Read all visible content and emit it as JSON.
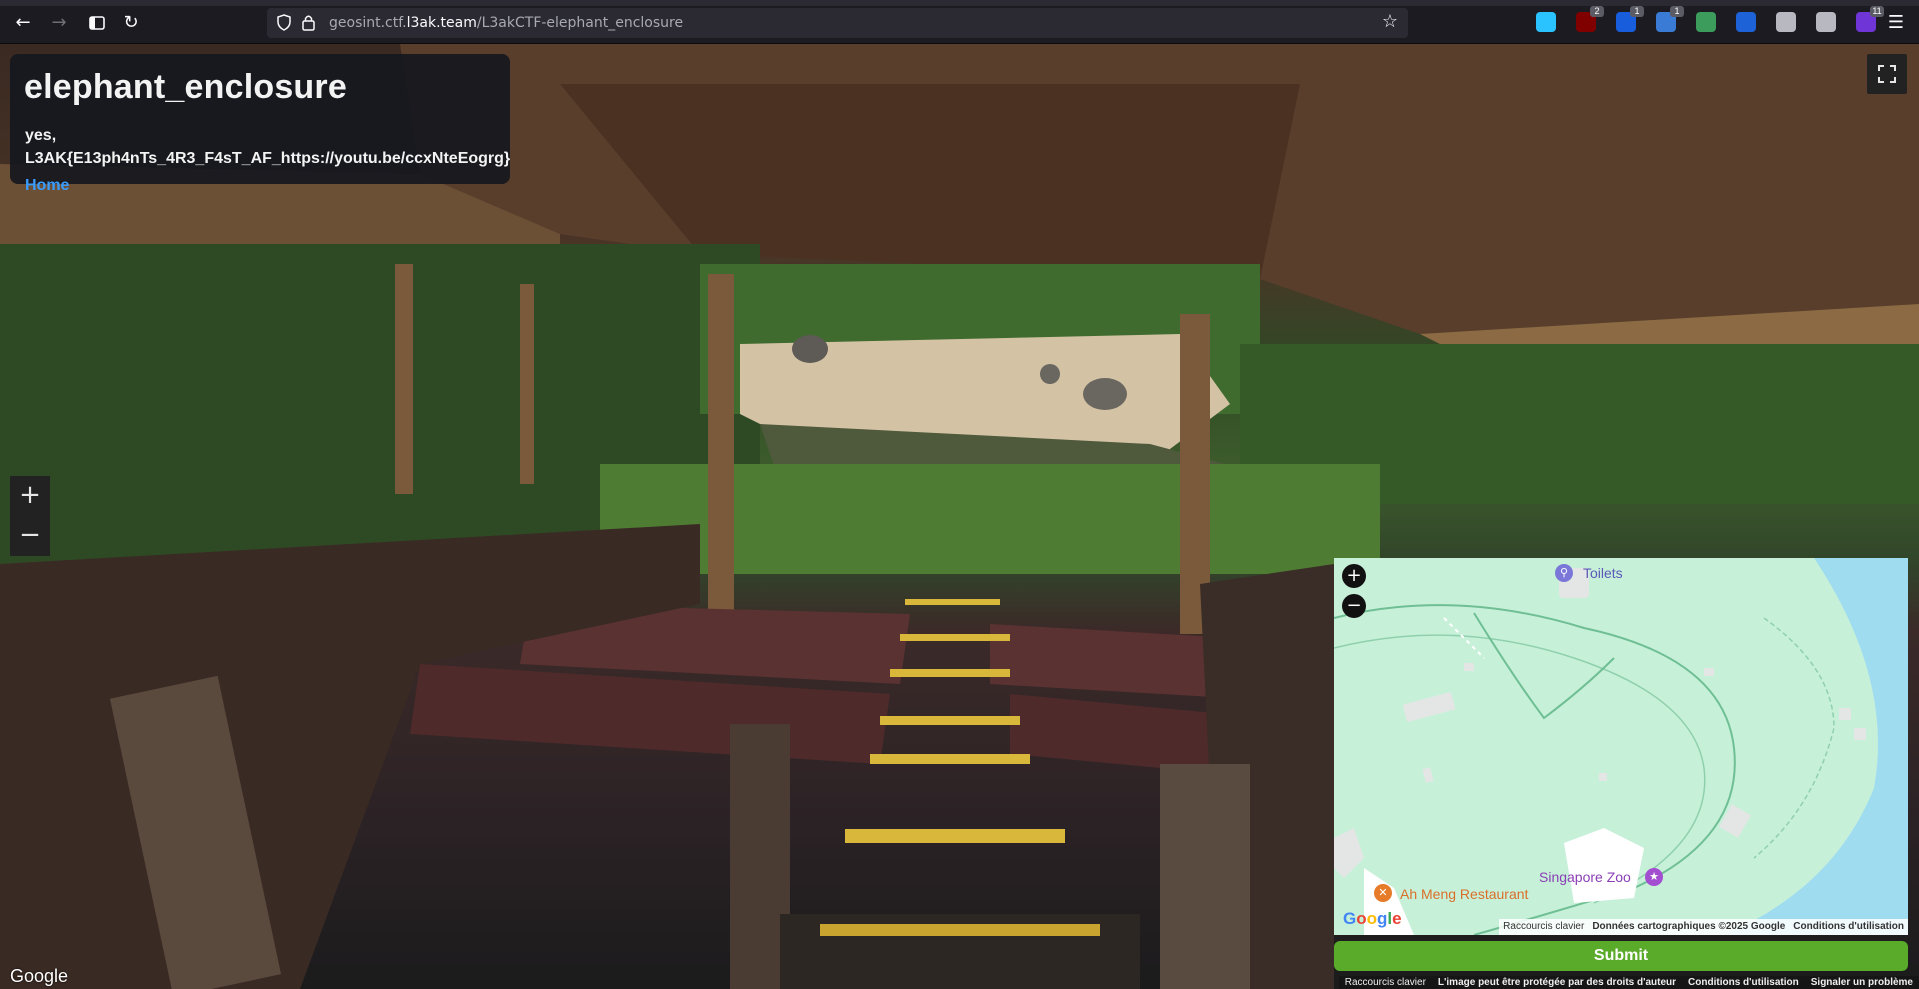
{
  "browser": {
    "url_prefix": "geosint.ctf.",
    "url_domain": "l3ak.team",
    "url_path": "/L3akCTF-elephant_enclosure",
    "extensions": [
      {
        "icon": "download-icon",
        "color": "#2ac3ff",
        "badge": ""
      },
      {
        "icon": "ublock-icon",
        "color": "#800000",
        "badge": "2"
      },
      {
        "icon": "bitwarden-icon",
        "color": "#175ddc",
        "badge": "1"
      },
      {
        "icon": "extension-blue-icon",
        "color": "#3a7bd5",
        "badge": "1"
      },
      {
        "icon": "spy-glasses-icon",
        "color": "#3c9c5c",
        "badge": ""
      },
      {
        "icon": "translate-icon",
        "color": "#1d62d6",
        "badge": ""
      },
      {
        "icon": "reader-icon",
        "color": "#b8b8c0",
        "badge": ""
      },
      {
        "icon": "puzzle-icon",
        "color": "#b8b8c0",
        "badge": ""
      },
      {
        "icon": "purple-extension-icon",
        "color": "#6f35d6",
        "badge": "11"
      }
    ]
  },
  "challenge": {
    "title": "elephant_enclosure",
    "flag_text": "yes, L3AK{E13ph4nTs_4R3_F4sT_AF_https://youtu.be/ccxNteEogrg}",
    "home_label": "Home"
  },
  "streetview": {
    "zoom_in": "+",
    "zoom_out": "−",
    "google_logo": "Google",
    "attribution": [
      "Raccourcis clavier",
      "L'image peut être protégée par des droits d'auteur",
      "Conditions d'utilisation",
      "Signaler un problème"
    ]
  },
  "minimap": {
    "zoom_in": "+",
    "zoom_out": "−",
    "pois": {
      "toilets": "Toilets",
      "singapore_zoo": "Singapore Zoo",
      "restaurant": "Ah Meng Restaurant"
    },
    "google_logo": "Google",
    "attribution": [
      "Raccourcis clavier",
      "Données cartographiques ©2025 Google",
      "Conditions d'utilisation"
    ]
  },
  "submit_label": "Submit",
  "colors": {
    "accent_link": "#3b9cff",
    "submit": "#5bab2a",
    "map_land": "#c7f0d9",
    "map_water": "#9fdcf0"
  }
}
